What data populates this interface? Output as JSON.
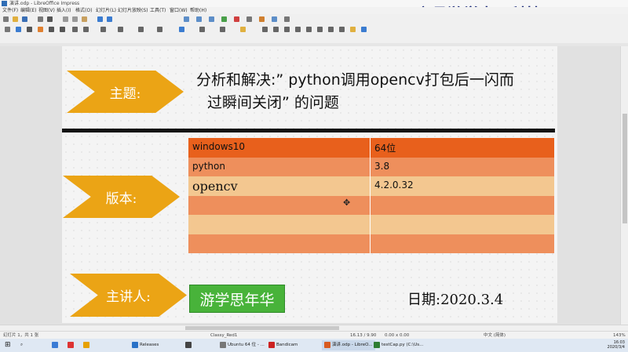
{
  "window": {
    "title": "演讲.odp - LibreOffice Impress"
  },
  "watermark": "义县游学电子科技yxzhw.cn",
  "menu": [
    "文件(F)",
    "编辑(E)",
    "视图(V)",
    "插入(I)",
    "格式(O)",
    "幻灯片(L)",
    "幻灯片放映(S)",
    "工具(T)",
    "窗口(W)",
    "帮助(H)"
  ],
  "slide": {
    "topic_label": "主题:",
    "topic_line1": "分析和解决:” python调用opencv打包后一闪而",
    "topic_line2": "过瞬间关闭” 的问题",
    "version_label": "版本:",
    "speaker_label": "主讲人:",
    "speaker_name": "游学思年华",
    "date": "日期:2020.3.4",
    "table": [
      {
        "k": "windows10",
        "v": "64位",
        "bg": "#e8601c"
      },
      {
        "k": "python",
        "v": "3.8",
        "bg": "#ee8f5c"
      },
      {
        "k": "opencv",
        "v": "4.2.0.32",
        "bg": "#f3c790"
      },
      {
        "k": "",
        "v": "",
        "bg": "#ee8f5c"
      },
      {
        "k": "",
        "v": "",
        "bg": "#f3c790"
      },
      {
        "k": "",
        "v": "",
        "bg": "#ee8f5c"
      }
    ]
  },
  "colors": {
    "arrow": "#eba415",
    "speaker_box": "#48b33a"
  },
  "status": {
    "left": "幻灯片 1，共 1 张",
    "layout": "Classy_Red1",
    "pos": "16.13 / 9.90",
    "size": "0.00 x 0.00",
    "lang": "中文 (简体)",
    "zoom": "143%"
  },
  "taskbar": {
    "items": [
      "Releases",
      "Ubuntu 64 位 - ...",
      "Bandicam",
      "演讲.odp - LibreO...",
      "testCap.py (C:\\Us..."
    ],
    "clock_time": "16:03",
    "clock_date": "2020/3/4"
  }
}
